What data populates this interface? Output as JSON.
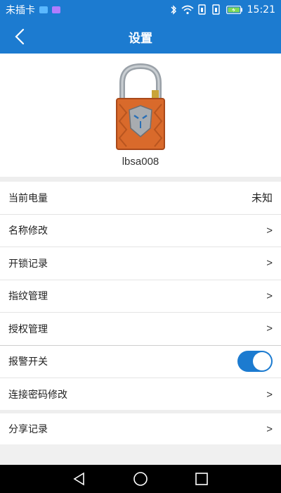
{
  "statusbar": {
    "carrier": "未插卡",
    "time": "15:21",
    "colors": {
      "badge1": "#5bb8ff",
      "badge2": "#b07dff"
    }
  },
  "appbar": {
    "title": "设置"
  },
  "device": {
    "name": "lbsa008",
    "icon": "padlock-icon"
  },
  "settings": [
    {
      "label": "当前电量",
      "value": "未知"
    },
    {
      "label": "名称修改",
      "chevron": ">"
    },
    {
      "label": "开锁记录",
      "chevron": ">"
    },
    {
      "label": "指纹管理",
      "chevron": ">"
    },
    {
      "label": "授权管理",
      "chevron": ">"
    },
    {
      "label": "报警开关",
      "toggle_on": true
    },
    {
      "label": "连接密码修改",
      "chevron": ">"
    }
  ],
  "share": {
    "label": "分享记录",
    "chevron": ">"
  },
  "theme": {
    "accent": "#1c7bd0"
  }
}
